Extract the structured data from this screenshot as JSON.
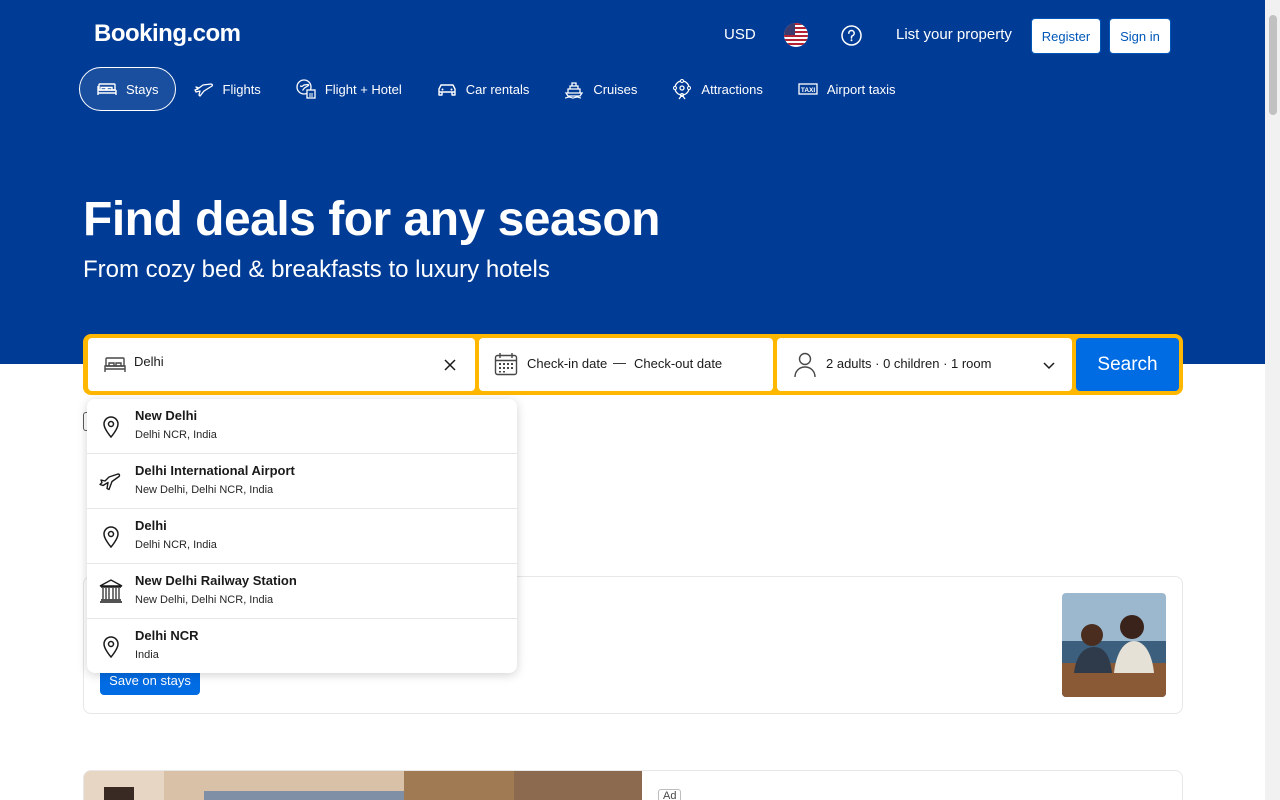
{
  "header": {
    "logo": "Booking.com",
    "currency": "USD",
    "list_property": "List your property",
    "register": "Register",
    "sign_in": "Sign in"
  },
  "nav": [
    {
      "label": "Stays",
      "icon": "bed-icon",
      "active": true
    },
    {
      "label": "Flights",
      "icon": "plane-icon"
    },
    {
      "label": "Flight + Hotel",
      "icon": "flight-hotel-icon"
    },
    {
      "label": "Car rentals",
      "icon": "car-icon"
    },
    {
      "label": "Cruises",
      "icon": "cruise-icon"
    },
    {
      "label": "Attractions",
      "icon": "attractions-icon"
    },
    {
      "label": "Airport taxis",
      "icon": "taxi-icon"
    }
  ],
  "hero": {
    "title": "Find deals for any season",
    "subtitle": "From cozy bed & breakfasts to luxury hotels"
  },
  "search": {
    "destination_value": "Delhi",
    "checkin": "Check-in date",
    "separator": "—",
    "checkout": "Check-out date",
    "guests": "2 adults · 0 children · 1 room",
    "button": "Search"
  },
  "suggestions": [
    {
      "title": "New Delhi",
      "subtitle": "Delhi NCR, India",
      "icon": "location-pin-icon"
    },
    {
      "title": "Delhi International Airport",
      "subtitle": "New Delhi, Delhi NCR, India",
      "icon": "airport-plane-icon"
    },
    {
      "title": "Delhi",
      "subtitle": "Delhi NCR, India",
      "icon": "location-pin-icon"
    },
    {
      "title": "New Delhi Railway Station",
      "subtitle": "New Delhi, Delhi NCR, India",
      "icon": "landmark-icon"
    },
    {
      "title": "Delhi NCR",
      "subtitle": "India",
      "icon": "location-pin-icon"
    }
  ],
  "promo": {
    "button": "Save on stays"
  },
  "ad": {
    "label": "Ad"
  },
  "colors": {
    "brand_blue": "#003b95",
    "action_blue": "#006ce4",
    "search_border": "#ffb700"
  }
}
